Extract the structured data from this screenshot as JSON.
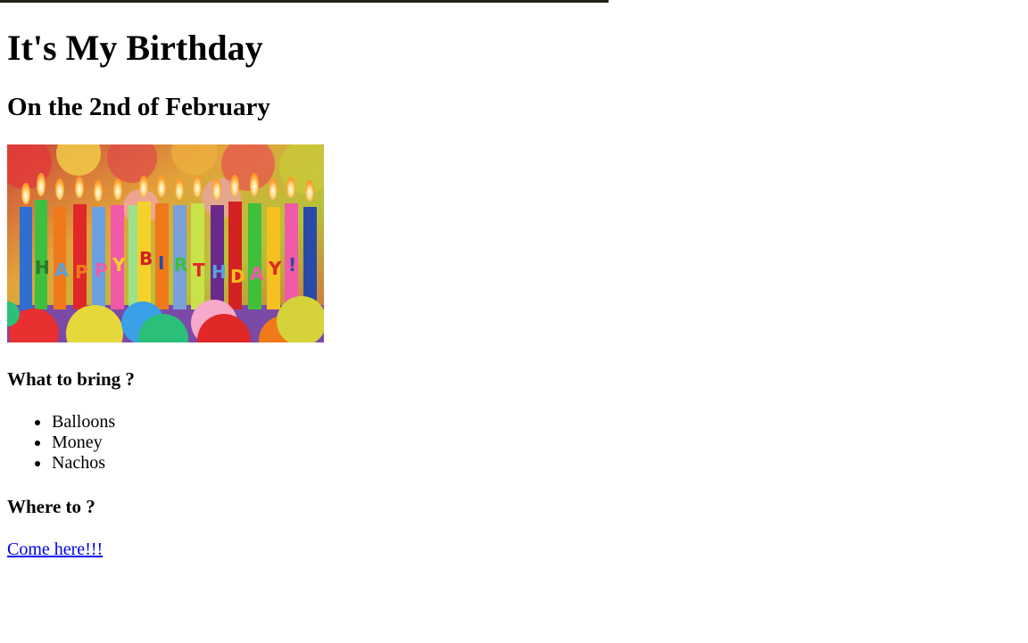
{
  "page": {
    "title": "It's My Birthday",
    "subtitle": "On the 2nd of February",
    "image_text": "HAPPY BIRTHDAY!",
    "bring": {
      "heading": "What to bring ?",
      "items": [
        "Balloons",
        "Money",
        "Nachos"
      ]
    },
    "where": {
      "heading": "Where to ?",
      "link_text": "Come here!!!"
    }
  },
  "colors": {
    "topbar": "#22221c",
    "link": "#0000ee"
  }
}
